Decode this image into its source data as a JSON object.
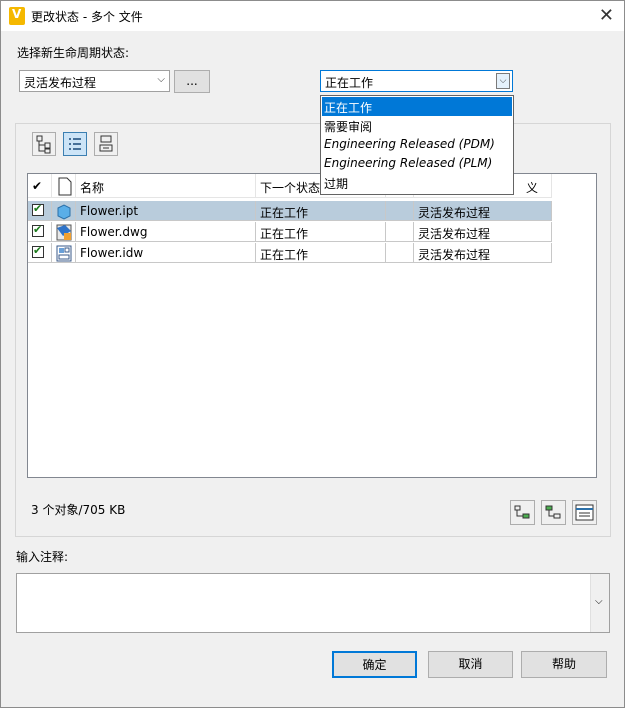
{
  "window": {
    "title": "更改状态 - 多个 文件",
    "app_icon_letter": "V",
    "close_glyph": "✕"
  },
  "lifecycle": {
    "label": "选择新生命周期状态:",
    "definition_value": "灵活发布过程",
    "browse_label": "...",
    "state_value": "正在工作"
  },
  "state_dropdown": {
    "options": [
      "正在工作",
      "需要审阅",
      "Engineering Released (PDM)",
      "Engineering Released (PLM)",
      "过期"
    ],
    "selected_index": 0
  },
  "grid": {
    "headers": {
      "check": "✔",
      "name": "名称",
      "next_state": "下一个状态",
      "hidden": "",
      "definition_tail": "义"
    },
    "rows": [
      {
        "name": "Flower.ipt",
        "next_state": "正在工作",
        "definition": "灵活发布过程",
        "checked": true,
        "selected": true
      },
      {
        "name": "Flower.dwg",
        "next_state": "正在工作",
        "definition": "灵活发布过程",
        "checked": true,
        "selected": false
      },
      {
        "name": "Flower.idw",
        "next_state": "正在工作",
        "definition": "灵活发布过程",
        "checked": true,
        "selected": false
      }
    ]
  },
  "status": {
    "summary": "3 个对象/705 KB"
  },
  "comment": {
    "label": "输入注释:",
    "value": ""
  },
  "buttons": {
    "ok": "确定",
    "cancel": "取消",
    "help": "帮助"
  },
  "colors": {
    "selection": "#0078d7",
    "row_selected": "#b9ccdc",
    "accent_icon": "#f5b800"
  }
}
